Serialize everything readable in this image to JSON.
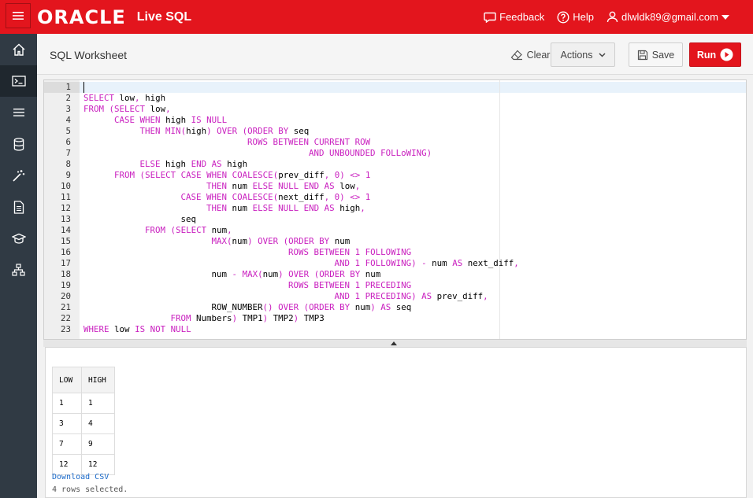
{
  "header": {
    "logo": "ORACLE",
    "product": "Live SQL",
    "feedback": "Feedback",
    "help": "Help",
    "user": "dlwldk89@gmail.com"
  },
  "toolbar": {
    "title": "SQL Worksheet",
    "clear": "Clear",
    "actions": "Actions",
    "save": "Save",
    "run": "Run"
  },
  "sidebar": {
    "items": [
      "home-icon",
      "sql-worksheet-icon",
      "menu-list-icon",
      "database-icon",
      "magic-wand-icon",
      "document-icon",
      "graduation-cap-icon",
      "sitemap-icon"
    ]
  },
  "editor": {
    "lines": [
      "",
      "SELECT low, high",
      "FROM (SELECT low,",
      "      CASE WHEN high IS NULL",
      "           THEN MIN(high) OVER (ORDER BY seq",
      "                                ROWS BETWEEN CURRENT ROW",
      "                                            AND UNBOUNDED FOLLoWING)",
      "           ELSE high END AS high",
      "      FROM (SELECT CASE WHEN COALESCE(prev_diff, 0) <> 1",
      "                        THEN num ELSE NULL END AS low,",
      "                   CASE WHEN COALESCE(next_diff, 0) <> 1",
      "                        THEN num ELSE NULL END AS high,",
      "                   seq",
      "            FROM (SELECT num,",
      "                         MAX(num) OVER (ORDER BY num",
      "                                        ROWS BETWEEN 1 FOLLOWING",
      "                                                 AND 1 FOLLOWING) - num AS next_diff,",
      "                         num - MAX(num) OVER (ORDER BY num",
      "                                        ROWS BETWEEN 1 PRECEDING",
      "                                                 AND 1 PRECEDING) AS prev_diff,",
      "                         ROW_NUMBER() OVER (ORDER BY num) AS seq",
      "                 FROM Numbers) TMP1) TMP2) TMP3",
      "WHERE low IS NOT NULL"
    ]
  },
  "results": {
    "columns": [
      "LOW",
      "HIGH"
    ],
    "rows": [
      [
        "1",
        "1"
      ],
      [
        "3",
        "4"
      ],
      [
        "7",
        "9"
      ],
      [
        "12",
        "12"
      ]
    ],
    "download": "Download CSV",
    "status": "4 rows selected."
  },
  "colors": {
    "brand": "#e3151d",
    "sidebar": "#303a44",
    "keyword": "#c91fbf",
    "link": "#1b6ac9"
  }
}
